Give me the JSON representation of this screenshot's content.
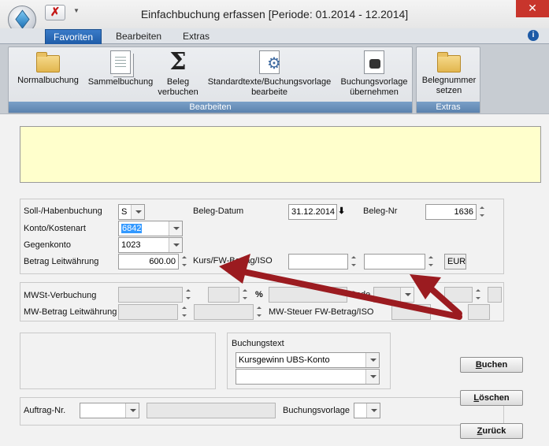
{
  "window": {
    "title": "Einfachbuchung erfassen  [Periode: 01.2014 - 12.2014]"
  },
  "tabs": [
    "Favoriten",
    "Bearbeiten",
    "Extras"
  ],
  "ribbon": {
    "groups": [
      {
        "caption": "Bearbeiten",
        "buttons": [
          {
            "label": "Normalbuchung",
            "icon": "folder-icon"
          },
          {
            "label": "Sammelbuchung",
            "icon": "documents-icon"
          },
          {
            "label": "Beleg\nverbuchen",
            "icon": "sigma-icon"
          },
          {
            "label": "Standardtexte/Buchungsvorlage\nbearbeite",
            "icon": "gear-document-icon"
          },
          {
            "label": "Buchungsvorlage\nübernehmen",
            "icon": "binoculars-document-icon"
          }
        ]
      },
      {
        "caption": "Extras",
        "buttons": [
          {
            "label": "Belegnummer\nsetzen",
            "icon": "folder-icon"
          }
        ]
      }
    ]
  },
  "form": {
    "soll_haben_label": "Soll-/Habenbuchung",
    "soll_haben_value": "S",
    "konto_label": "Konto/Kostenart",
    "konto_value": "6842",
    "gegenkonto_label": "Gegenkonto",
    "gegenkonto_value": "1023",
    "betrag_label": "Betrag Leitwährung",
    "betrag_value": "600.00",
    "beleg_datum_label": "Beleg-Datum",
    "beleg_datum_value": "31.12.2014",
    "beleg_nr_label": "Beleg-Nr",
    "beleg_nr_value": "1636",
    "kurs_label": "Kurs/FW-Betrag/ISO",
    "kurs_value": "",
    "fw_betrag_value": "",
    "iso_value": "EUR",
    "mwst_label": "MWSt-Verbuchung",
    "percent_label": "%",
    "code_label": "Code",
    "mw_betrag_label": "MW-Betrag Leitwährung",
    "mw_steuer_label": "MW-Steuer FW-Betrag/ISO",
    "buchungstext_label": "Buchungstext",
    "buchungstext_line1": "Kursgewinn UBS-Konto",
    "buchungstext_line2": "",
    "auftrag_label": "Auftrag-Nr.",
    "auftrag_value": "",
    "buchungsvorlage_label": "Buchungsvorlage",
    "buchungsvorlage_value": ""
  },
  "buttons": {
    "buchen_prefix": "B",
    "buchen_rest": "uchen",
    "loeschen_prefix": "L",
    "loeschen_rest": "öschen",
    "zurueck_prefix": "Z",
    "zurueck_rest": "urück"
  },
  "colors": {
    "accent": "#1d5aa6",
    "notice_bg": "#ffffcc",
    "annotation_arrow": "#9b1b20",
    "close": "#c8352c"
  }
}
